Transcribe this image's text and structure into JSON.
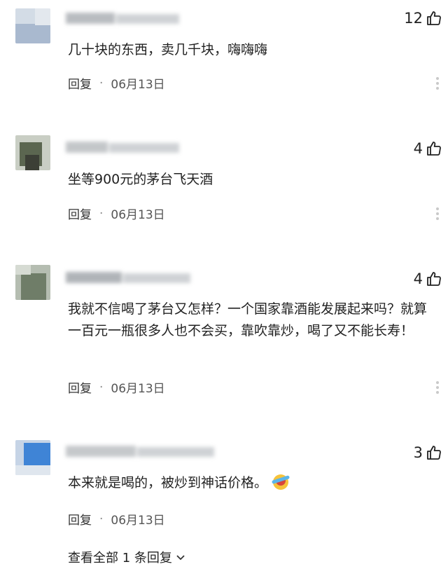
{
  "comments": [
    {
      "likes": "12",
      "text": "几十块的东西，卖几千块，嗨嗨嗨",
      "reply_label": "回复",
      "separator": "·",
      "date": "06月13日"
    },
    {
      "likes": "4",
      "text": "坐等900元的茅台飞天酒",
      "reply_label": "回复",
      "separator": "·",
      "date": "06月13日"
    },
    {
      "likes": "4",
      "text": "我就不信喝了茅台又怎样？一个国家靠酒能发展起来吗？就算一百元一瓶很多人也不会买，靠吹靠炒，喝了又不能长寿！",
      "reply_label": "回复",
      "separator": "·",
      "date": "06月13日"
    },
    {
      "likes": "3",
      "text": "本来就是喝的，被炒到神话价格。",
      "reply_label": "回复",
      "separator": "·",
      "date": "06月13日",
      "emoji": "laughing-crying-emoji"
    }
  ],
  "footer": {
    "view_all_label": "查看全部 1 条回复",
    "icon": "chevron-down-icon"
  },
  "icons": {
    "like": "thumbs-up-icon",
    "more": "more-vertical-icon"
  }
}
